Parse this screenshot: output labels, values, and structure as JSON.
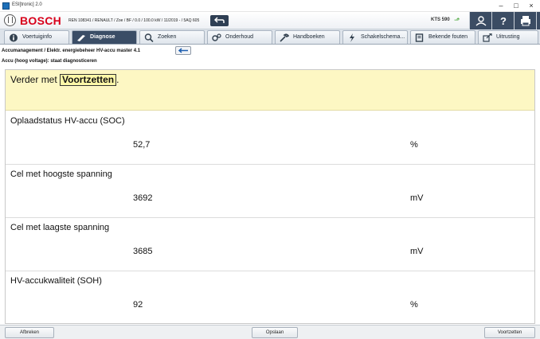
{
  "window": {
    "title": "ESI[tronic] 2.0",
    "minimize_glyph": "–",
    "maximize_glyph": "□",
    "close_glyph": "×"
  },
  "header": {
    "brand": "BOSCH",
    "vehicle": "REN 108341 / RENAULT / Zoe / BF / 0.0 / 100.0 kW / 11/2019 - / 5AQ 605",
    "device": "KTS 590",
    "icons": [
      "back-arrow-icon",
      "bluetooth-icon",
      "user-icon",
      "help-icon",
      "print-icon",
      "menu-icon"
    ]
  },
  "tabs": [
    {
      "label": "Voertuiginfo",
      "icon": "info-icon",
      "active": false
    },
    {
      "label": "Diagnose",
      "icon": "diagnose-icon",
      "active": true
    },
    {
      "label": "Zoeken",
      "icon": "search-icon",
      "active": false
    },
    {
      "label": "Onderhoud",
      "icon": "gears-icon",
      "active": false
    },
    {
      "label": "Handboeken",
      "icon": "wrench-icon",
      "active": false
    },
    {
      "label": "Schakelschema...",
      "icon": "lightning-icon",
      "active": false
    },
    {
      "label": "Bekende fouten",
      "icon": "book-icon",
      "active": false
    },
    {
      "label": "Uitrusting",
      "icon": "external-icon",
      "active": false
    }
  ],
  "breadcrumb": {
    "path": "Accumanagement / Elektr. energiebeheer HV-accu master 4.1",
    "subtitle": "Accu (hoog voltage): staat diagnosticeren"
  },
  "prompt": {
    "prefix": "Verder met ",
    "key": "Voortzetten",
    "suffix": "."
  },
  "measurements": [
    {
      "label": "Oplaadstatus HV-accu (SOC)",
      "value": "52,7",
      "unit": "%"
    },
    {
      "label": "Cel met hoogste spanning",
      "value": "3692",
      "unit": "mV"
    },
    {
      "label": "Cel met laagste spanning",
      "value": "3685",
      "unit": "mV"
    },
    {
      "label": "HV-accukwaliteit (SOH)",
      "value": "92",
      "unit": "%"
    }
  ],
  "footer": {
    "cancel_label": "Afbreken",
    "save_label": "Opslaan",
    "continue_label": "Voortzetten"
  },
  "colors": {
    "brand_red": "#d8001b",
    "active_tab": "#3a4d66",
    "prompt_background": "#fdf7c3"
  }
}
